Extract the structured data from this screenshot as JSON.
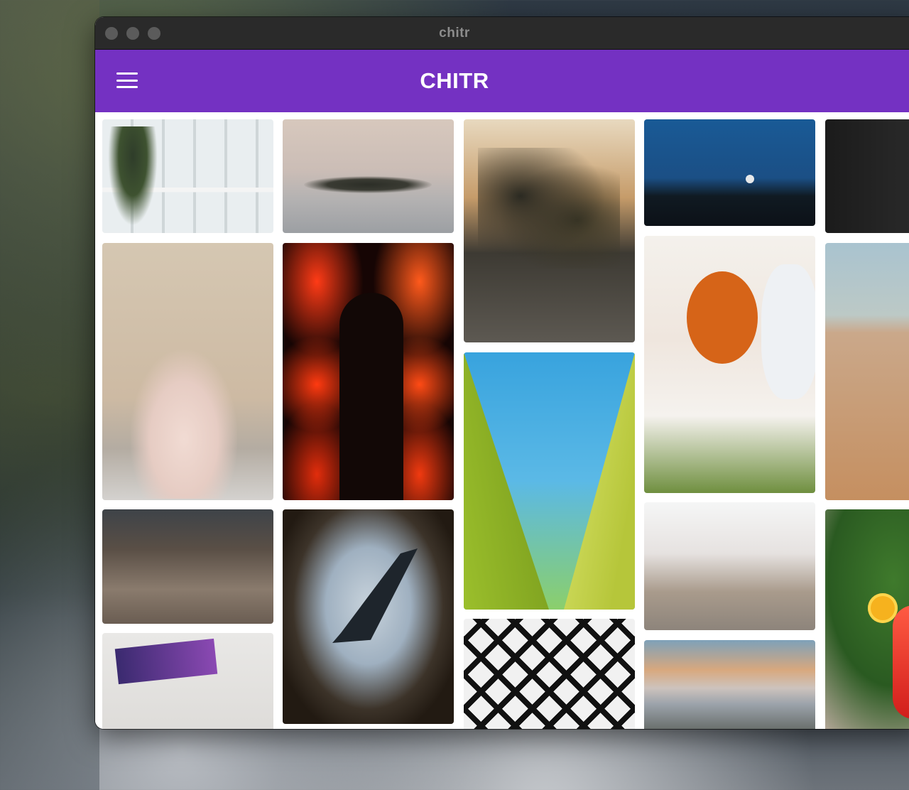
{
  "window": {
    "title": "chitr"
  },
  "appbar": {
    "title": "CHITR",
    "menu_icon": "hamburger-menu-icon"
  },
  "photos": [
    {
      "id": "office",
      "alt": "office"
    },
    {
      "id": "fog-island",
      "alt": "fog island"
    },
    {
      "id": "street",
      "alt": "street"
    },
    {
      "id": "moon",
      "alt": "moon"
    },
    {
      "id": "dark-interior",
      "alt": "dark interior"
    },
    {
      "id": "woman-dress",
      "alt": "woman dress"
    },
    {
      "id": "lanterns",
      "alt": "lanterns"
    },
    {
      "id": "green-walls",
      "alt": "green walls"
    },
    {
      "id": "cooking",
      "alt": "cooking"
    },
    {
      "id": "desert",
      "alt": "desert"
    },
    {
      "id": "rocky-shore",
      "alt": "rocky shore"
    },
    {
      "id": "plane-window",
      "alt": "plane window"
    },
    {
      "id": "mural-street",
      "alt": "mural street"
    },
    {
      "id": "cocktail",
      "alt": "cocktail"
    },
    {
      "id": "desk-setup",
      "alt": "desk setup"
    },
    {
      "id": "lattice",
      "alt": "lattice"
    },
    {
      "id": "sunset-fog",
      "alt": "sunset fog"
    }
  ]
}
